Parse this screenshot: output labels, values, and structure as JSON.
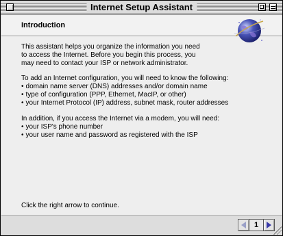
{
  "window": {
    "title": "Internet Setup Assistant"
  },
  "header": {
    "title": "Introduction"
  },
  "body": {
    "paragraph1": [
      "This assistant helps you organize the information you need",
      "to access the Internet. Before you begin this process, you",
      "may need to contact your ISP or network administrator."
    ],
    "paragraph2_intro": "To add an Internet configuration, you will need to know the following:",
    "paragraph2_items": [
      "domain name server (DNS) addresses and/or domain name",
      "type of configuration (PPP, Ethernet, MacIP, or other)",
      "your Internet Protocol (IP) address, subnet mask, router addresses"
    ],
    "paragraph3_intro": "In addition, if you access the Internet via a modem, you will need:",
    "paragraph3_items": [
      "your ISP's phone number",
      "your user name and password as registered with the ISP"
    ],
    "continue_hint": "Click the right arrow to continue."
  },
  "footer": {
    "page_number": "1"
  },
  "icons": {
    "globe": "globe-icon",
    "back": "left-arrow-icon",
    "forward": "right-arrow-icon"
  },
  "colors": {
    "arrow_enabled": "#3a3aa8",
    "arrow_disabled": "#9aa0c8"
  }
}
